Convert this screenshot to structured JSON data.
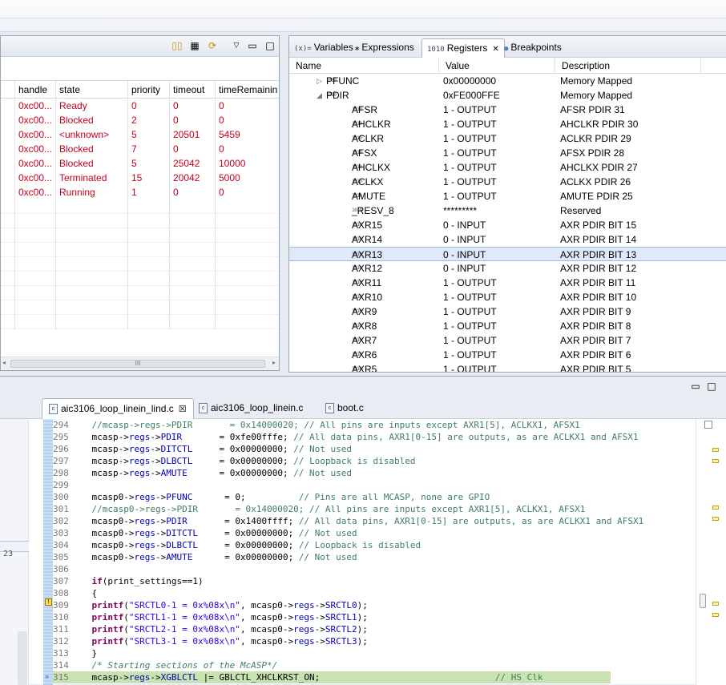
{
  "left_panel": {
    "columns": [
      "handle",
      "state",
      "priority",
      "timeout",
      "timeRemainin"
    ],
    "rows": [
      {
        "handle": "0xc00...",
        "state": "Ready",
        "priority": "0",
        "timeout": "0",
        "remaining": "0"
      },
      {
        "handle": "0xc00...",
        "state": "Blocked",
        "priority": "2",
        "timeout": "0",
        "remaining": "0"
      },
      {
        "handle": "0xc00...",
        "state": "<unknown>",
        "priority": "5",
        "timeout": "20501",
        "remaining": "5459"
      },
      {
        "handle": "0xc00...",
        "state": "Blocked",
        "priority": "7",
        "timeout": "0",
        "remaining": "0"
      },
      {
        "handle": "0xc00...",
        "state": "Blocked",
        "priority": "5",
        "timeout": "25042",
        "remaining": "10000"
      },
      {
        "handle": "0xc00...",
        "state": "Terminated",
        "priority": "15",
        "timeout": "20042",
        "remaining": "5000"
      },
      {
        "handle": "0xc00...",
        "state": "Running",
        "priority": "1",
        "timeout": "0",
        "remaining": "0"
      }
    ],
    "scroll_thumb_label": "III"
  },
  "right_panel": {
    "tabs": [
      {
        "icon": "(x)=",
        "label": "Variables"
      },
      {
        "icon": "✱",
        "label": "Expressions"
      },
      {
        "icon": "1010",
        "label": "Registers"
      },
      {
        "icon": "●",
        "label": "Breakpoints"
      }
    ],
    "columns": [
      "Name",
      "Value",
      "Description"
    ],
    "rows": [
      {
        "name": "PFUNC",
        "value": "0x00000000",
        "desc": "Memory Mapped",
        "level": 0,
        "expander": "▷"
      },
      {
        "name": "PDIR",
        "value": "0xFE000FFE",
        "desc": "Memory Mapped",
        "level": 0,
        "expander": "◢"
      },
      {
        "name": "AFSR",
        "value": "1 - OUTPUT",
        "desc": "AFSR PDIR 31",
        "level": 1
      },
      {
        "name": "AHCLKR",
        "value": "1 - OUTPUT",
        "desc": "AHCLKR PDIR 30",
        "level": 1
      },
      {
        "name": "ACLKR",
        "value": "1 - OUTPUT",
        "desc": "ACLKR PDIR 29",
        "level": 1
      },
      {
        "name": "AFSX",
        "value": "1 - OUTPUT",
        "desc": "AFSX PDIR 28",
        "level": 1
      },
      {
        "name": "AHCLKX",
        "value": "1 - OUTPUT",
        "desc": "AHCLKX PDIR 27",
        "level": 1
      },
      {
        "name": "ACLKX",
        "value": "1 - OUTPUT",
        "desc": "ACLKX PDIR 26",
        "level": 1
      },
      {
        "name": "AMUTE",
        "value": "1 - OUTPUT",
        "desc": "AMUTE PDIR 25",
        "level": 1
      },
      {
        "name": "_RESV_8",
        "value": "*********",
        "desc": "Reserved",
        "level": 1
      },
      {
        "name": "AXR15",
        "value": "0 - INPUT",
        "desc": "AXR PDIR BIT 15",
        "level": 1
      },
      {
        "name": "AXR14",
        "value": "0 - INPUT",
        "desc": "AXR PDIR BIT 14",
        "level": 1
      },
      {
        "name": "AXR13",
        "value": "0 - INPUT",
        "desc": "AXR PDIR BIT 13",
        "level": 1,
        "selected": true
      },
      {
        "name": "AXR12",
        "value": "0 - INPUT",
        "desc": "AXR PDIR BIT 12",
        "level": 1
      },
      {
        "name": "AXR11",
        "value": "1 - OUTPUT",
        "desc": "AXR PDIR BIT 11",
        "level": 1
      },
      {
        "name": "AXR10",
        "value": "1 - OUTPUT",
        "desc": "AXR PDIR BIT 10",
        "level": 1
      },
      {
        "name": "AXR9",
        "value": "1 - OUTPUT",
        "desc": "AXR PDIR BIT 9",
        "level": 1
      },
      {
        "name": "AXR8",
        "value": "1 - OUTPUT",
        "desc": "AXR PDIR BIT 8",
        "level": 1
      },
      {
        "name": "AXR7",
        "value": "1 - OUTPUT",
        "desc": "AXR PDIR BIT 7",
        "level": 1
      },
      {
        "name": "AXR6",
        "value": "1 - OUTPUT",
        "desc": "AXR PDIR BIT 6",
        "level": 1
      },
      {
        "name": "AXR5",
        "value": "1 - OUTPUT",
        "desc": "AXR PDIR BIT 5",
        "level": 1
      }
    ],
    "bits_icon": "1010 0101"
  },
  "editor": {
    "tabs": [
      {
        "label": "aic3106_loop_linein_lind.c",
        "close": "☒",
        "active": true
      },
      {
        "label": "aic3106_loop_linein.c",
        "active": false
      },
      {
        "label": "boot.c",
        "active": false
      }
    ],
    "file_icon": "c",
    "left_number": "23",
    "lines": [
      {
        "n": "294",
        "code": [
          [
            "cm",
            "    //mcasp->regs->PDIR       = 0x14000020; // All pins are inputs except AXR1[5], ACLKX1, AFSX1"
          ]
        ]
      },
      {
        "n": "295",
        "code": [
          [
            "",
            "    mcasp->"
          ],
          [
            "fld",
            "regs"
          ],
          [
            "",
            "->"
          ],
          [
            "fld",
            "PDIR"
          ],
          [
            "",
            "       = 0xfe00fffe; "
          ],
          [
            "cm",
            "// All data pins, AXR1[0-15] are outputs, as are ACLKX1 and AFSX1"
          ]
        ]
      },
      {
        "n": "296",
        "code": [
          [
            "",
            "    mcasp->"
          ],
          [
            "fld",
            "regs"
          ],
          [
            "",
            "->"
          ],
          [
            "fld",
            "DITCTL"
          ],
          [
            "",
            "     = 0x00000000; "
          ],
          [
            "cm",
            "// Not used"
          ]
        ]
      },
      {
        "n": "297",
        "code": [
          [
            "",
            "    mcasp->"
          ],
          [
            "fld",
            "regs"
          ],
          [
            "",
            "->"
          ],
          [
            "fld",
            "DLBCTL"
          ],
          [
            "",
            "     = 0x00000000; "
          ],
          [
            "cm",
            "// Loopback is disabled"
          ]
        ]
      },
      {
        "n": "298",
        "code": [
          [
            "",
            "    mcasp->"
          ],
          [
            "fld",
            "regs"
          ],
          [
            "",
            "->"
          ],
          [
            "fld",
            "AMUTE"
          ],
          [
            "",
            "      = 0x00000000; "
          ],
          [
            "cm",
            "// Not used"
          ]
        ]
      },
      {
        "n": "299",
        "code": []
      },
      {
        "n": "300",
        "code": [
          [
            "",
            "    mcasp0->"
          ],
          [
            "fld",
            "regs"
          ],
          [
            "",
            "->"
          ],
          [
            "fld",
            "PFUNC"
          ],
          [
            "",
            "      = 0;          "
          ],
          [
            "cm",
            "// Pins are all MCASP, none are GPIO"
          ]
        ]
      },
      {
        "n": "301",
        "code": [
          [
            "cm",
            "    //mcasp0->regs->PDIR       = 0x14000020; // All pins are inputs except AXR1[5], ACLKX1, AFSX1"
          ]
        ]
      },
      {
        "n": "302",
        "code": [
          [
            "",
            "    mcasp0->"
          ],
          [
            "fld",
            "regs"
          ],
          [
            "",
            "->"
          ],
          [
            "fld",
            "PDIR"
          ],
          [
            "",
            "       = 0x1400ffff; "
          ],
          [
            "cm",
            "// All data pins, AXR1[0-15] are outputs, as are ACLKX1 and AFSX1"
          ]
        ]
      },
      {
        "n": "303",
        "code": [
          [
            "",
            "    mcasp0->"
          ],
          [
            "fld",
            "regs"
          ],
          [
            "",
            "->"
          ],
          [
            "fld",
            "DITCTL"
          ],
          [
            "",
            "     = 0x00000000; "
          ],
          [
            "cm",
            "// Not used"
          ]
        ]
      },
      {
        "n": "304",
        "code": [
          [
            "",
            "    mcasp0->"
          ],
          [
            "fld",
            "regs"
          ],
          [
            "",
            "->"
          ],
          [
            "fld",
            "DLBCTL"
          ],
          [
            "",
            "     = 0x00000000; "
          ],
          [
            "cm",
            "// Loopback is disabled"
          ]
        ]
      },
      {
        "n": "305",
        "code": [
          [
            "",
            "    mcasp0->"
          ],
          [
            "fld",
            "regs"
          ],
          [
            "",
            "->"
          ],
          [
            "fld",
            "AMUTE"
          ],
          [
            "",
            "      = 0x00000000; "
          ],
          [
            "cm",
            "// Not used"
          ]
        ]
      },
      {
        "n": "306",
        "code": []
      },
      {
        "n": "307",
        "code": [
          [
            "kw",
            "    if"
          ],
          [
            "",
            "(print_settings==1)"
          ]
        ]
      },
      {
        "n": "308",
        "code": [
          [
            "",
            "    {"
          ]
        ]
      },
      {
        "n": "309",
        "code": [
          [
            "kw",
            "    printf"
          ],
          [
            "",
            "("
          ],
          [
            "str",
            "\"SRCTL0-1 = 0x%08x\\n\""
          ],
          [
            "",
            ", mcasp0->"
          ],
          [
            "fld",
            "regs"
          ],
          [
            "",
            "->"
          ],
          [
            "fld",
            "SRCTL0"
          ],
          [
            "",
            ");"
          ]
        ]
      },
      {
        "n": "310",
        "code": [
          [
            "kw",
            "    printf"
          ],
          [
            "",
            "("
          ],
          [
            "str",
            "\"SRCTL1-1 = 0x%08x\\n\""
          ],
          [
            "",
            ", mcasp0->"
          ],
          [
            "fld",
            "regs"
          ],
          [
            "",
            "->"
          ],
          [
            "fld",
            "SRCTL1"
          ],
          [
            "",
            ");"
          ]
        ]
      },
      {
        "n": "311",
        "code": [
          [
            "kw",
            "    printf"
          ],
          [
            "",
            "("
          ],
          [
            "str",
            "\"SRCTL2-1 = 0x%08x\\n\""
          ],
          [
            "",
            ", mcasp0->"
          ],
          [
            "fld",
            "regs"
          ],
          [
            "",
            "->"
          ],
          [
            "fld",
            "SRCTL2"
          ],
          [
            "",
            ");"
          ]
        ]
      },
      {
        "n": "312",
        "code": [
          [
            "kw",
            "    printf"
          ],
          [
            "",
            "("
          ],
          [
            "str",
            "\"SRCTL3-1 = 0x%08x\\n\""
          ],
          [
            "",
            ", mcasp0->"
          ],
          [
            "fld",
            "regs"
          ],
          [
            "",
            "->"
          ],
          [
            "fld",
            "SRCTL3"
          ],
          [
            "",
            ");"
          ]
        ]
      },
      {
        "n": "313",
        "code": [
          [
            "",
            "    }"
          ]
        ]
      },
      {
        "n": "314",
        "code": [
          [
            "cmi",
            "    /* Starting sections of the McASP*/"
          ]
        ]
      },
      {
        "n": "315",
        "code": [
          [
            "",
            "    mcasp->"
          ],
          [
            "fld",
            "regs"
          ],
          [
            "",
            "->"
          ],
          [
            "fld",
            "XGBLCTL"
          ],
          [
            "",
            " |= GBLCTL_XHCLKRST_ON;                                 "
          ],
          [
            "cm",
            "// HS Clk"
          ]
        ],
        "current": true
      }
    ]
  }
}
